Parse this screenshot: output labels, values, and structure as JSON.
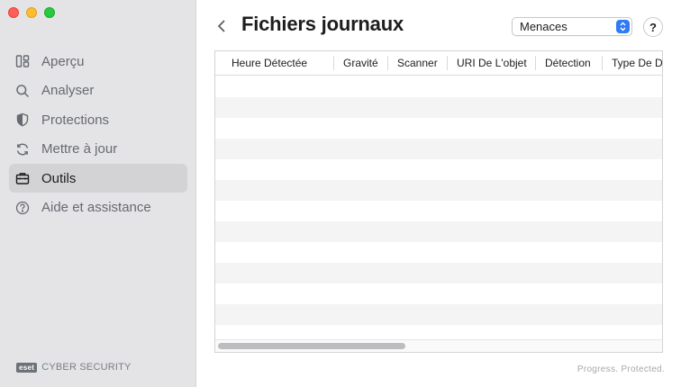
{
  "sidebar": {
    "items": [
      {
        "label": "Aperçu",
        "icon": "overview-icon",
        "active": false
      },
      {
        "label": "Analyser",
        "icon": "search-icon",
        "active": false
      },
      {
        "label": "Protections",
        "icon": "shield-icon",
        "active": false
      },
      {
        "label": "Mettre à jour",
        "icon": "refresh-icon",
        "active": false
      },
      {
        "label": "Outils",
        "icon": "briefcase-icon",
        "active": true
      },
      {
        "label": "Aide et assistance",
        "icon": "help-circle-icon",
        "active": false
      }
    ],
    "brand_logo": "eset",
    "brand_text": "CYBER SECURITY"
  },
  "header": {
    "title": "Fichiers journaux",
    "log_type_select": "Menaces",
    "help_label": "?"
  },
  "table": {
    "columns": [
      "Heure Détectée",
      "Gravité",
      "Scanner",
      "URI De L'objet",
      "Détection",
      "Type De Dé"
    ],
    "rows": []
  },
  "footer": {
    "tagline": "Progress. Protected."
  },
  "colors": {
    "accent": "#2f7bf5",
    "sidebar_bg": "#e4e4e6",
    "active_item_bg": "#d3d3d6"
  }
}
